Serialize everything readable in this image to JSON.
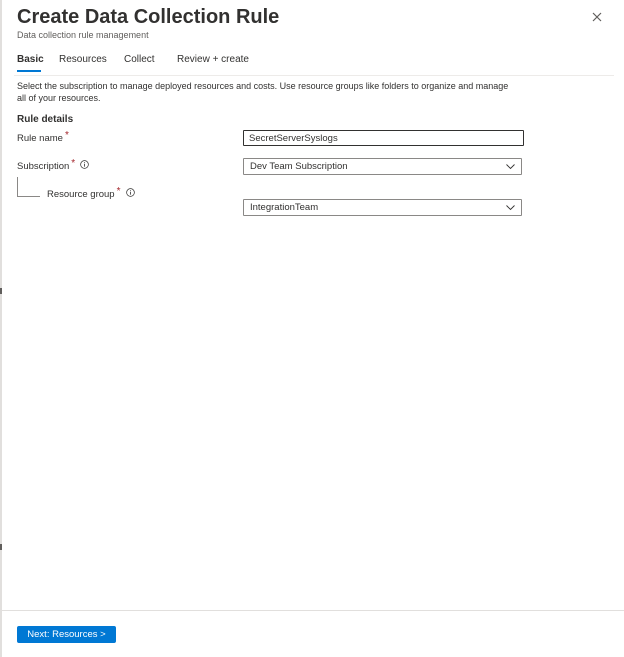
{
  "panel": {
    "title": "Create Data Collection Rule",
    "subtitle": "Data collection rule management"
  },
  "tabs": [
    {
      "label": "Basic",
      "active": true
    },
    {
      "label": "Resources",
      "active": false
    },
    {
      "label": "Collect",
      "active": false
    },
    {
      "label": "Review + create",
      "active": false
    }
  ],
  "description": "Select the subscription to manage deployed resources and costs. Use resource groups like folders to organize and manage all of your resources.",
  "rule_details": {
    "heading": "Rule details",
    "rule_name": {
      "label": "Rule name",
      "required_mark": "*",
      "value": "SecretServerSyslogs"
    },
    "subscription": {
      "label": "Subscription",
      "required_mark": "*",
      "value": "Dev Team Subscription"
    },
    "resource_group": {
      "label": "Resource group",
      "required_mark": "*",
      "value": "IntegrationTeam"
    }
  },
  "footer": {
    "next_label": "Next: Resources >"
  },
  "colors": {
    "accent": "#0078d4",
    "required": "#a4262c",
    "text": "#323130",
    "border": "#8a8886"
  },
  "icons": {
    "close": "close-icon",
    "info": "info-icon",
    "chevron": "chevron-down-icon"
  }
}
